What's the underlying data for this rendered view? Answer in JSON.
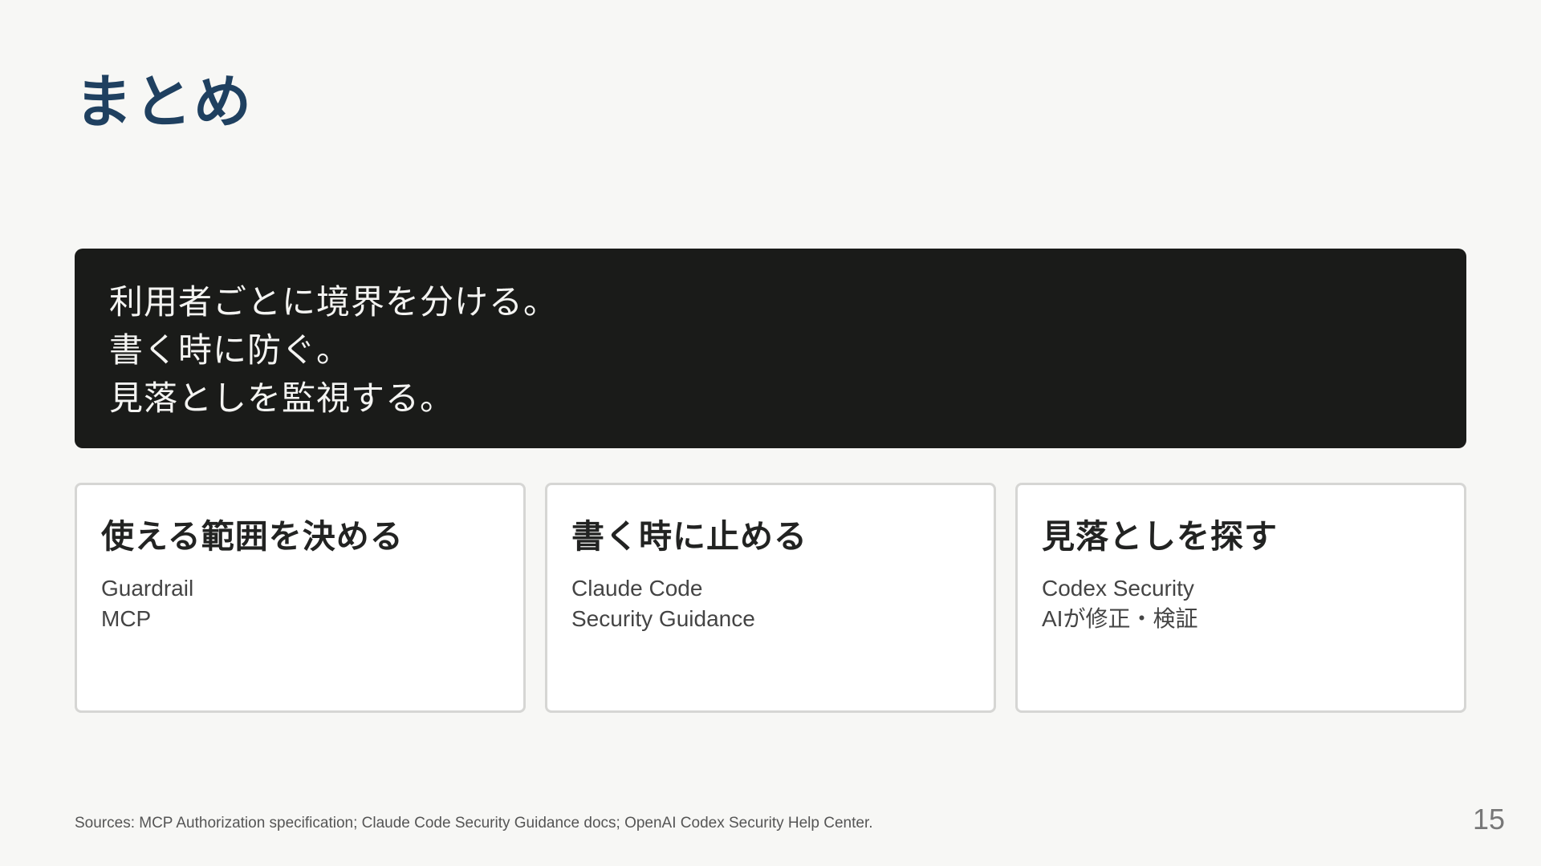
{
  "slide": {
    "title": "まとめ",
    "page_number": "15",
    "sources": "Sources: MCP Authorization specification; Claude Code Security Guidance docs; OpenAI Codex Security Help Center."
  },
  "hero": {
    "lines": [
      "利用者ごとに境界を分ける。",
      "書く時に防ぐ。",
      "見落としを監視する。"
    ]
  },
  "cards": [
    {
      "title": "使える範囲を決める",
      "lines": [
        "Guardrail",
        "MCP"
      ]
    },
    {
      "title": "書く時に止める",
      "lines": [
        "Claude Code",
        "Security Guidance"
      ]
    },
    {
      "title": "見落としを探す",
      "lines": [
        "Codex Security",
        "AIが修正・検証"
      ]
    }
  ],
  "colors": {
    "background": "#f7f7f5",
    "title": "#1f4060",
    "hero_background": "#1a1b19",
    "hero_text": "#f4f4f2",
    "card_border": "#d6d6d4"
  }
}
